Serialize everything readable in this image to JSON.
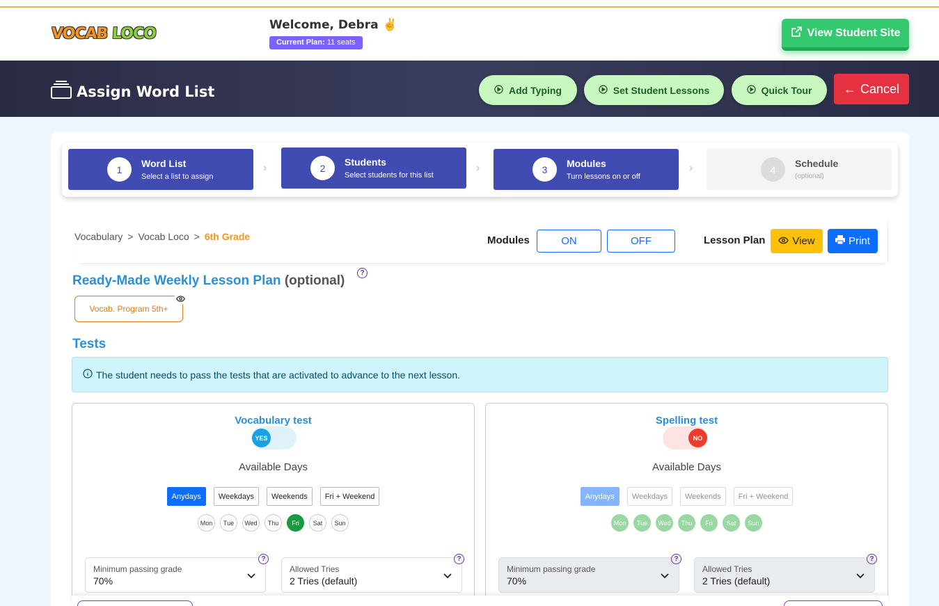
{
  "topbar": {
    "logo_a": "VOCAB",
    "logo_b": "LOCO",
    "welcome": "Welcome, Debra ✌️",
    "plan_label": "Current Plan:",
    "plan_value": "11 seats",
    "view_student_site": "View Student Site"
  },
  "header": {
    "title": "Assign Word List",
    "add_typing": "Add Typing",
    "set_student_lessons": "Set Student Lessons",
    "quick_tour": "Quick Tour",
    "cancel": "Cancel"
  },
  "steps": [
    {
      "num": "1",
      "title": "Word List",
      "sub": "Select a list to assign"
    },
    {
      "num": "2",
      "title": "Students",
      "sub": "Select students for this list"
    },
    {
      "num": "3",
      "title": "Modules",
      "sub": "Turn lessons on or off"
    },
    {
      "num": "4",
      "title": "Schedule",
      "sub": "(optional)"
    }
  ],
  "breadcrumb": {
    "a": "Vocabulary",
    "b": "Vocab Loco",
    "c": "6th Grade",
    "sep": ">"
  },
  "modules": {
    "label": "Modules",
    "on": "ON",
    "off": "OFF"
  },
  "lesson_plan": {
    "label": "Lesson Plan",
    "view": "View",
    "print": "Print"
  },
  "ready_made": {
    "title": "Ready-Made Weekly Lesson Plan",
    "optional": "(optional)",
    "program": "Vocab. Program 5th+"
  },
  "tests": {
    "title": "Tests",
    "info": "The student needs to pass the tests that are activated to advance to the next lesson.",
    "vocab": {
      "title": "Vocabulary test",
      "toggle": "YES",
      "available": "Available Days",
      "day_buttons": [
        "Anydays",
        "Weekdays",
        "Weekends",
        "Fri + Weekend"
      ],
      "days": [
        "Mon",
        "Tue",
        "Wed",
        "Thu",
        "Fri",
        "Sat",
        "Sun"
      ],
      "min_label": "Minimum passing grade",
      "min_value": "70%",
      "tries_label": "Allowed Tries",
      "tries_value": "2 Tries (default)"
    },
    "spelling": {
      "title": "Spelling test",
      "toggle": "NO",
      "available": "Available Days",
      "day_buttons": [
        "Anydays",
        "Weekdays",
        "Weekends",
        "Fri + Weekend"
      ],
      "days": [
        "Mon",
        "Tue",
        "Wed",
        "Thu",
        "Fri",
        "Sat",
        "Sun"
      ],
      "min_label": "Minimum passing grade",
      "min_value": "70%",
      "tries_label": "Allowed Tries",
      "tries_value": "2 Tries (default)"
    }
  },
  "colors": {
    "primary": "#3f4bb0",
    "accent": "#2b8fd8",
    "orange": "#f7941d",
    "cancel": "#e53140",
    "green": "#34c96f"
  }
}
